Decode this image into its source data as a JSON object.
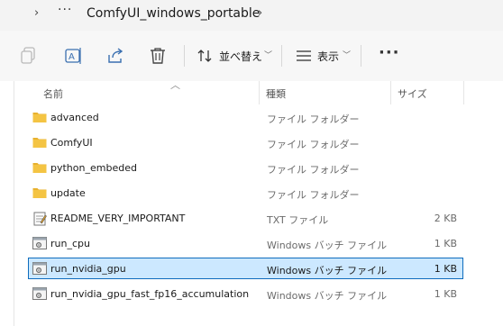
{
  "breadcrumb": {
    "more": "···",
    "folder": "ComfyUI_windows_portable"
  },
  "toolbar": {
    "sort_label": "並べ替え",
    "view_label": "表示",
    "more": "···"
  },
  "columns": {
    "name": "名前",
    "type": "種類",
    "size": "サイズ"
  },
  "files": [
    {
      "name": "advanced",
      "type": "ファイル フォルダー",
      "size": "",
      "icon": "folder-icon"
    },
    {
      "name": "ComfyUI",
      "type": "ファイル フォルダー",
      "size": "",
      "icon": "folder-icon"
    },
    {
      "name": "python_embeded",
      "type": "ファイル フォルダー",
      "size": "",
      "icon": "folder-icon"
    },
    {
      "name": "update",
      "type": "ファイル フォルダー",
      "size": "",
      "icon": "folder-icon"
    },
    {
      "name": "README_VERY_IMPORTANT",
      "type": "TXT ファイル",
      "size": "2 KB",
      "icon": "text-file-icon"
    },
    {
      "name": "run_cpu",
      "type": "Windows バッチ ファイル",
      "size": "1 KB",
      "icon": "batch-file-icon"
    },
    {
      "name": "run_nvidia_gpu",
      "type": "Windows バッチ ファイル",
      "size": "1 KB",
      "icon": "batch-file-icon",
      "selected": true
    },
    {
      "name": "run_nvidia_gpu_fast_fp16_accumulation",
      "type": "Windows バッチ ファイル",
      "size": "1 KB",
      "icon": "batch-file-icon"
    }
  ],
  "colors": {
    "folder": "#f4c443",
    "selection_bg": "#cce8ff",
    "selection_border": "#0f6cbd"
  }
}
